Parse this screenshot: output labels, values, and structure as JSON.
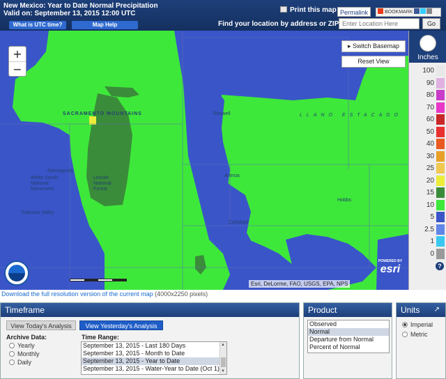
{
  "header": {
    "title_line1": "New Mexico: Year to Date Normal Precipitation",
    "title_line2": "Valid on: September 13, 2015 12:00 UTC",
    "utc_button": "What is UTC time?",
    "help_button": "Map Help",
    "print_label": "Print this map",
    "permalink_label": "Permalink",
    "bookmark_label": "BOOKMARK",
    "find_label": "Find your location by address or ZIP code:",
    "location_placeholder": "Enter Location Here",
    "go_label": "Go"
  },
  "map": {
    "switch_basemap": "Switch Basemap",
    "reset_view": "Reset View",
    "zoom_in": "+",
    "zoom_out": "−",
    "attribution": "Esri, DeLorme, FAO, USGS, EPA, NPS",
    "powered_by": "POWERED BY",
    "esri_logo": "esri",
    "noaa_logo": "NOAA",
    "places": [
      "SACRAMENTO MOUNTAINS",
      "Alamogordo",
      "White Sands National Monument",
      "Lincoln National Forest",
      "Tularosa Valley",
      "Roswell",
      "Artesia",
      "Carlsbad",
      "Hobbs",
      "LLANO ESTACADO"
    ],
    "colors": {
      "blue": "#3a55c8",
      "green": "#3ee83a",
      "dark_green": "#3a8c3a",
      "yellow": "#ecec3a"
    }
  },
  "legend": {
    "unit": "Inches",
    "help": "?",
    "items": [
      {
        "label": "100",
        "color": "#e8e8e8"
      },
      {
        "label": "90",
        "color": "#e0b0e0"
      },
      {
        "label": "80",
        "color": "#c93cc9"
      },
      {
        "label": "70",
        "color": "#e838c8"
      },
      {
        "label": "60",
        "color": "#c82828"
      },
      {
        "label": "50",
        "color": "#e83030"
      },
      {
        "label": "40",
        "color": "#e85a20"
      },
      {
        "label": "30",
        "color": "#e8a028"
      },
      {
        "label": "25",
        "color": "#f0c850"
      },
      {
        "label": "20",
        "color": "#ecec3a"
      },
      {
        "label": "15",
        "color": "#3a8c3a"
      },
      {
        "label": "10",
        "color": "#3ee83a"
      },
      {
        "label": "5",
        "color": "#3a55c8"
      },
      {
        "label": "2.5",
        "color": "#5f86e8"
      },
      {
        "label": "1",
        "color": "#3ac8f0"
      },
      {
        "label": "0",
        "color": "#9a9a9a"
      }
    ]
  },
  "download": {
    "link_text": "Download the full resolution version of the current map",
    "size_text": " (4000x2250 pixels)"
  },
  "timeframe": {
    "title": "Timeframe",
    "today_button": "View Today's Analysis",
    "yesterday_button": "View Yesterday's Analysis",
    "archive_label": "Archive Data:",
    "archive_options": [
      "Yearly",
      "Monthly",
      "Daily"
    ],
    "time_range_label": "Time Range:",
    "ranges": [
      "September 13, 2015 - Last 180 Days",
      "September 13, 2015 - Month to Date",
      "September 13, 2015 - Year to Date",
      "September 13, 2015 - Water-Year to Date (Oct 1)"
    ],
    "selected_range_index": 2
  },
  "product": {
    "title": "Product",
    "options": [
      "Observed",
      "Normal",
      "Departure from Normal",
      "Percent of Normal"
    ],
    "selected_index": 1
  },
  "units": {
    "title": "Units",
    "expand_icon": "↗",
    "options": [
      "Imperial",
      "Metric"
    ],
    "selected": "Imperial"
  }
}
